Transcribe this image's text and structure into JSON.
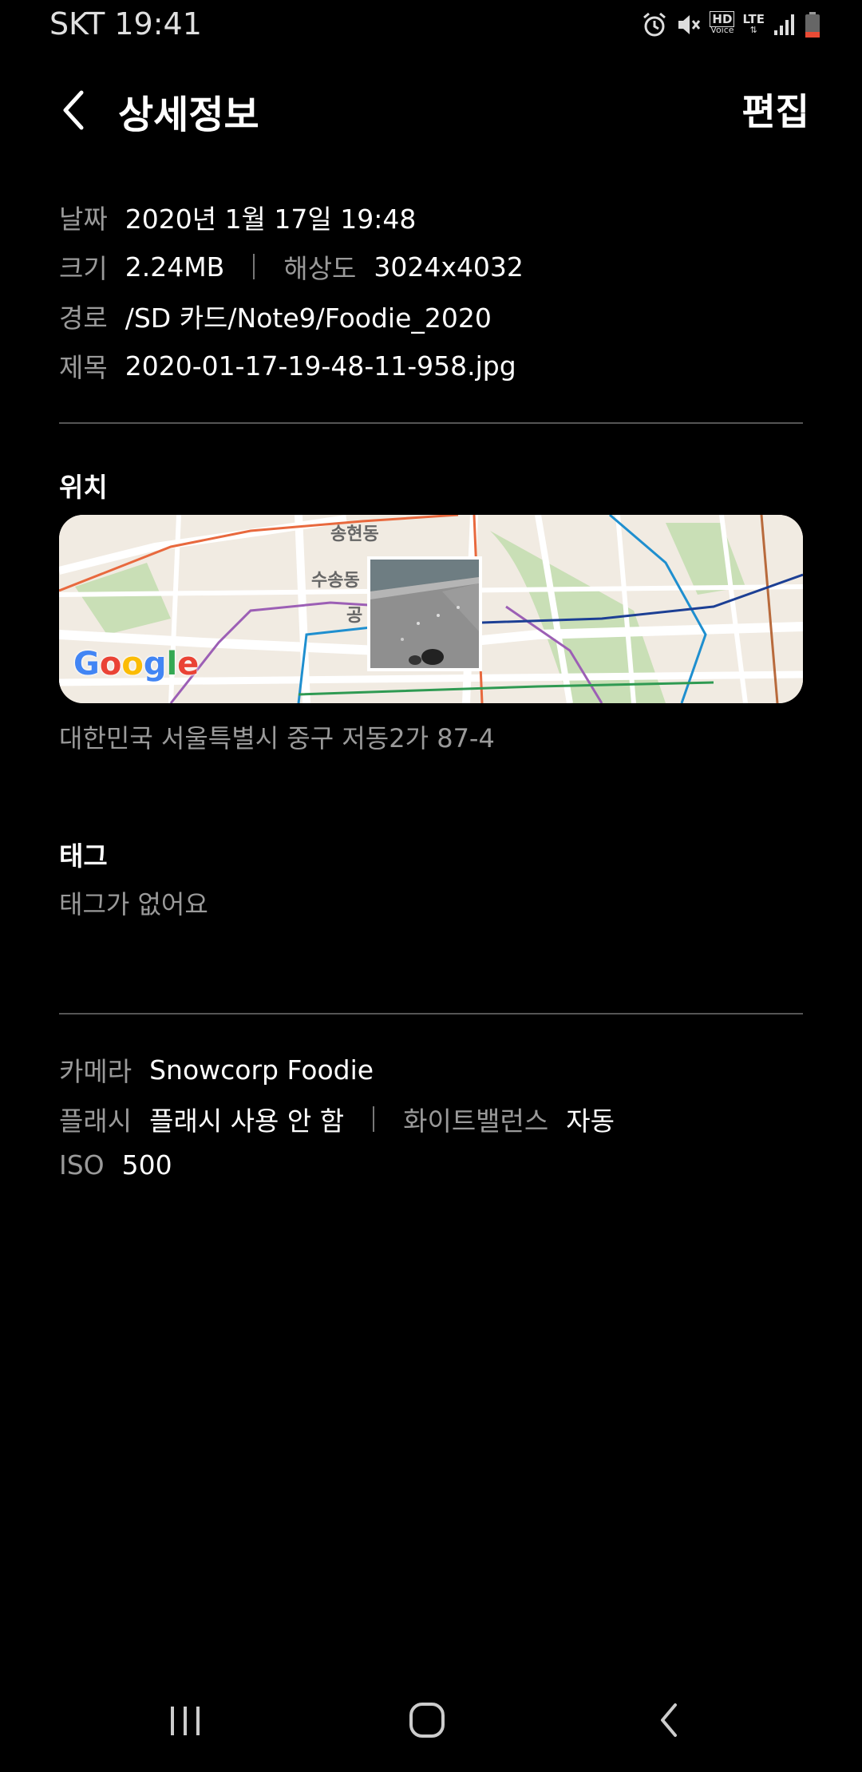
{
  "status_bar": {
    "carrier_time": "SKT 19:41",
    "hd_voice": "HD",
    "voice": "Voice",
    "lte": "LTE"
  },
  "header": {
    "title": "상세정보",
    "edit_label": "편집"
  },
  "details": {
    "date_label": "날짜",
    "date_value": "2020년 1월 17일 19:48",
    "size_label": "크기",
    "size_value": "2.24MB",
    "resolution_label": "해상도",
    "resolution_value": "3024x4032",
    "path_label": "경로",
    "path_value": "/SD 카드/Note9/Foodie_2020",
    "name_label": "제목",
    "name_value": "2020-01-17-19-48-11-958.jpg"
  },
  "location": {
    "heading": "위치",
    "map_labels": {
      "area1": "송현동",
      "area2": "수송동",
      "area3": "공"
    },
    "map_logo": [
      "G",
      "o",
      "o",
      "g",
      "l",
      "e"
    ],
    "address": "대한민국 서울특별시 중구 저동2가 87-4"
  },
  "tags": {
    "heading": "태그",
    "empty_text": "태그가 없어요"
  },
  "camera": {
    "camera_label": "카메라",
    "camera_value": "Snowcorp Foodie",
    "flash_label": "플래시",
    "flash_value": "플래시 사용 안 함",
    "wb_label": "화이트밸런스",
    "wb_value": "자동",
    "iso_label": "ISO",
    "iso_value": "500"
  },
  "colors": {
    "background": "#000000",
    "label_gray": "#9a9a9a",
    "divider": "#555555"
  },
  "icons": [
    "alarm-icon",
    "mute-icon",
    "hd-voice-icon",
    "lte-icon",
    "signal-icon",
    "battery-icon",
    "back-icon",
    "recent-apps-icon",
    "home-icon",
    "nav-back-icon"
  ]
}
